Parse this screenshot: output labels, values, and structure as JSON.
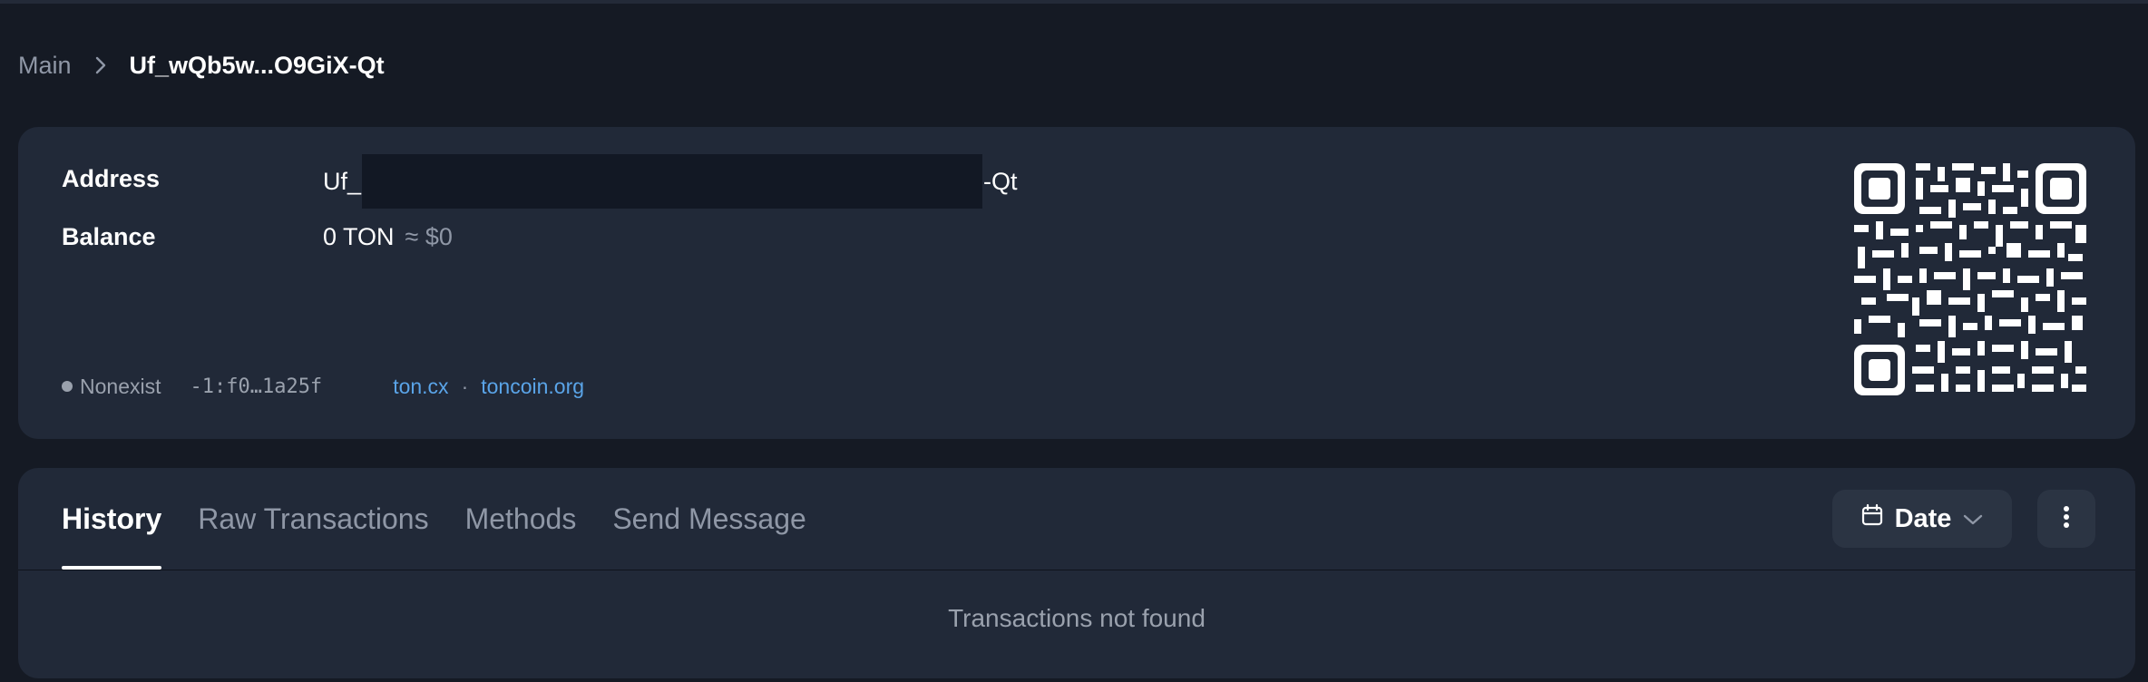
{
  "breadcrumb": {
    "root_label": "Main",
    "current_label": "Uf_wQb5w...O9GiX-Qt"
  },
  "account": {
    "address_label": "Address",
    "address_prefix": "Uf_",
    "address_suffix": "-Qt",
    "balance_label": "Balance",
    "balance_value": "0 TON",
    "balance_fiat": "≈ $0",
    "status_text": "Nonexist",
    "raw_address": "-1:f0…1a25f",
    "explorer_link_1": "ton.cx",
    "link_separator": "·",
    "explorer_link_2": "toncoin.org"
  },
  "tabs": [
    {
      "label": "History",
      "active": true
    },
    {
      "label": "Raw Transactions",
      "active": false
    },
    {
      "label": "Methods",
      "active": false
    },
    {
      "label": "Send Message",
      "active": false
    }
  ],
  "toolbar": {
    "date_label": "Date"
  },
  "history": {
    "empty_message": "Transactions not found"
  },
  "icons": {
    "breadcrumb_separator": "chevron-right-icon",
    "date_button": "calendar-icon",
    "date_dropdown": "chevron-down-icon",
    "more_button": "more-vertical-icon",
    "qr": "qr-code-icon"
  },
  "colors": {
    "background": "#151a24",
    "card": "#212938",
    "button": "#2b3443",
    "link": "#5aa4e8",
    "muted_text": "#8f97a6",
    "redaction": "#121824"
  }
}
